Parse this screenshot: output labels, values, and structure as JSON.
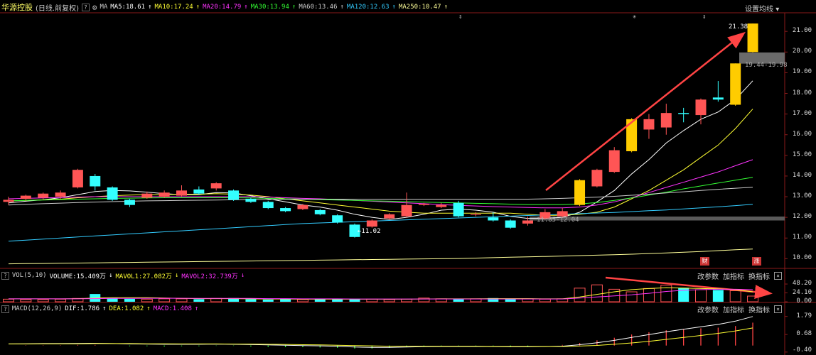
{
  "header": {
    "stock_name": "华源控股",
    "period": "(日线.前复权)",
    "help": "?",
    "indicator": "MA",
    "ma_items": [
      {
        "label": "MA5:18.61",
        "color": "#ffffff"
      },
      {
        "label": "MA10:17.24",
        "color": "#ffff33"
      },
      {
        "label": "MA20:14.79",
        "color": "#ff33ff"
      },
      {
        "label": "MA30:13.94",
        "color": "#33ff33"
      },
      {
        "label": "MA60:13.46",
        "color": "#cccccc"
      },
      {
        "label": "MA120:12.63",
        "color": "#33ccff"
      },
      {
        "label": "MA250:10.47",
        "color": "#ffff99"
      }
    ],
    "settings_label": "设置均线"
  },
  "price_axis": [
    "21.00",
    "20.00",
    "19.00",
    "18.00",
    "17.00",
    "16.00",
    "15.00",
    "14.00",
    "13.00",
    "12.00",
    "11.00",
    "10.00"
  ],
  "annotations": {
    "high_label": "21.38",
    "low_label": "11.02",
    "range_label_right": "19.44-19.98",
    "range_label_mid": "11.85-12.04"
  },
  "badges": {
    "cai": "财",
    "zhang": "涨"
  },
  "volume_panel": {
    "help": "?",
    "title": "VOL(5,10)",
    "volume": "VOLUME:15.409万",
    "mavol1": "MAVOL1:27.082万",
    "mavol2": "MAVOL2:32.739万",
    "tools": [
      "改参数",
      "加指标",
      "换指标"
    ],
    "close": "×",
    "axis": [
      "48.20",
      "24.10",
      "0.00"
    ]
  },
  "macd_panel": {
    "help": "?",
    "title": "MACD(12,26,9)",
    "dif": "DIF:1.786",
    "dea": "DEA:1.082",
    "macd": "MACD:1.408",
    "tools": [
      "改参数",
      "加指标",
      "换指标"
    ],
    "close": "×",
    "axis": [
      "1.79",
      "0.68",
      "-0.40"
    ]
  },
  "chart_data": {
    "type": "candlestick",
    "price_range": [
      9.6,
      21.9
    ],
    "candles": [
      {
        "o": 12.75,
        "c": 12.85,
        "h": 13.0,
        "l": 12.6
      },
      {
        "o": 12.9,
        "c": 13.05,
        "h": 13.1,
        "l": 12.8
      },
      {
        "o": 12.95,
        "c": 13.15,
        "h": 13.2,
        "l": 12.85
      },
      {
        "o": 13.0,
        "c": 13.2,
        "h": 13.3,
        "l": 12.9
      },
      {
        "o": 13.45,
        "c": 14.3,
        "h": 14.35,
        "l": 13.4
      },
      {
        "o": 14.0,
        "c": 13.5,
        "h": 14.1,
        "l": 13.3
      },
      {
        "o": 13.45,
        "c": 12.85,
        "h": 13.5,
        "l": 12.8
      },
      {
        "o": 12.85,
        "c": 12.6,
        "h": 12.9,
        "l": 12.5
      },
      {
        "o": 12.95,
        "c": 13.15,
        "h": 13.25,
        "l": 12.9
      },
      {
        "o": 13.0,
        "c": 13.2,
        "h": 13.3,
        "l": 12.95
      },
      {
        "o": 13.05,
        "c": 13.3,
        "h": 13.55,
        "l": 13.0
      },
      {
        "o": 13.35,
        "c": 13.15,
        "h": 13.5,
        "l": 13.1
      },
      {
        "o": 13.4,
        "c": 13.65,
        "h": 13.7,
        "l": 13.3
      },
      {
        "o": 13.3,
        "c": 12.85,
        "h": 13.35,
        "l": 12.8
      },
      {
        "o": 12.9,
        "c": 12.75,
        "h": 12.95,
        "l": 12.7
      },
      {
        "o": 12.75,
        "c": 12.45,
        "h": 12.8,
        "l": 12.4
      },
      {
        "o": 12.45,
        "c": 12.3,
        "h": 12.5,
        "l": 12.25
      },
      {
        "o": 12.4,
        "c": 12.6,
        "h": 12.65,
        "l": 12.35
      },
      {
        "o": 12.35,
        "c": 12.15,
        "h": 12.4,
        "l": 12.1
      },
      {
        "o": 12.1,
        "c": 11.75,
        "h": 12.15,
        "l": 11.7
      },
      {
        "o": 11.65,
        "c": 11.05,
        "h": 11.7,
        "l": 11.02
      },
      {
        "o": 11.55,
        "c": 11.85,
        "h": 11.9,
        "l": 11.5
      },
      {
        "o": 11.95,
        "c": 12.15,
        "h": 12.2,
        "l": 11.9
      },
      {
        "o": 12.05,
        "c": 12.6,
        "h": 13.2,
        "l": 12.0
      },
      {
        "o": 12.6,
        "c": 12.65,
        "h": 12.7,
        "l": 12.55
      },
      {
        "o": 12.5,
        "c": 12.6,
        "h": 12.7,
        "l": 12.45
      },
      {
        "o": 12.7,
        "c": 12.05,
        "h": 12.8,
        "l": 12.0
      },
      {
        "o": 12.15,
        "c": 12.15,
        "h": 12.25,
        "l": 12.05
      },
      {
        "o": 12.0,
        "c": 11.85,
        "h": 12.25,
        "l": 11.8
      },
      {
        "o": 11.85,
        "c": 11.5,
        "h": 11.9,
        "l": 11.45
      },
      {
        "o": 11.7,
        "c": 11.85,
        "h": 12.04,
        "l": 11.6
      },
      {
        "o": 11.95,
        "c": 12.25,
        "h": 12.4,
        "l": 11.9
      },
      {
        "o": 12.05,
        "c": 12.3,
        "h": 12.45,
        "l": 12.0
      },
      {
        "o": 12.6,
        "c": 13.8,
        "h": 13.85,
        "l": 12.55
      },
      {
        "o": 13.5,
        "c": 14.3,
        "h": 14.35,
        "l": 13.45
      },
      {
        "o": 14.2,
        "c": 15.25,
        "h": 15.4,
        "l": 14.15
      },
      {
        "o": 15.2,
        "c": 16.75,
        "h": 16.8,
        "l": 15.15
      },
      {
        "o": 16.25,
        "c": 16.75,
        "h": 17.0,
        "l": 15.8
      },
      {
        "o": 16.35,
        "c": 17.05,
        "h": 17.5,
        "l": 16.0
      },
      {
        "o": 17.05,
        "c": 17.0,
        "h": 17.3,
        "l": 16.6
      },
      {
        "o": 16.95,
        "c": 17.7,
        "h": 17.75,
        "l": 16.5
      },
      {
        "o": 17.8,
        "c": 17.7,
        "h": 18.6,
        "l": 17.6
      },
      {
        "o": 17.45,
        "c": 19.45,
        "h": 19.45,
        "l": 17.4
      },
      {
        "o": 20.0,
        "c": 21.38,
        "h": 21.38,
        "l": 19.98
      }
    ],
    "ma_series": [
      {
        "name": "MA5",
        "color": "#ffffff",
        "values": [
          12.7,
          12.78,
          12.85,
          12.95,
          13.1,
          13.25,
          13.3,
          13.28,
          13.22,
          13.15,
          13.1,
          13.1,
          13.2,
          13.18,
          13.05,
          12.9,
          12.75,
          12.6,
          12.5,
          12.35,
          12.15,
          12.0,
          11.9,
          12.0,
          12.15,
          12.35,
          12.4,
          12.35,
          12.25,
          12.05,
          11.95,
          11.95,
          12.0,
          12.25,
          12.75,
          13.3,
          14.1,
          14.8,
          15.6,
          16.2,
          16.75,
          17.1,
          17.7,
          18.61
        ]
      },
      {
        "name": "MA10",
        "color": "#ffff33",
        "values": [
          12.8,
          12.82,
          12.85,
          12.88,
          12.95,
          13.0,
          13.05,
          13.08,
          13.1,
          13.1,
          13.12,
          13.12,
          13.15,
          13.12,
          13.08,
          13.0,
          12.9,
          12.8,
          12.7,
          12.6,
          12.5,
          12.4,
          12.3,
          12.25,
          12.2,
          12.2,
          12.2,
          12.2,
          12.2,
          12.2,
          12.15,
          12.1,
          12.1,
          12.15,
          12.25,
          12.5,
          12.9,
          13.3,
          13.8,
          14.3,
          14.9,
          15.5,
          16.3,
          17.24
        ]
      },
      {
        "name": "MA20",
        "color": "#ff33ff",
        "values": [
          12.9,
          12.92,
          12.94,
          12.96,
          12.98,
          13.0,
          13.0,
          13.0,
          13.0,
          13.0,
          13.0,
          13.0,
          13.0,
          13.0,
          13.0,
          12.98,
          12.95,
          12.92,
          12.9,
          12.86,
          12.82,
          12.78,
          12.74,
          12.7,
          12.66,
          12.62,
          12.58,
          12.55,
          12.52,
          12.5,
          12.48,
          12.46,
          12.46,
          12.5,
          12.6,
          12.75,
          12.95,
          13.2,
          13.45,
          13.7,
          13.95,
          14.2,
          14.5,
          14.79
        ]
      },
      {
        "name": "MA30",
        "color": "#33ff33",
        "values": [
          12.8,
          12.82,
          12.84,
          12.86,
          12.88,
          12.9,
          12.92,
          12.93,
          12.94,
          12.95,
          12.95,
          12.95,
          12.95,
          12.95,
          12.94,
          12.92,
          12.9,
          12.88,
          12.86,
          12.84,
          12.82,
          12.8,
          12.78,
          12.76,
          12.74,
          12.72,
          12.7,
          12.68,
          12.66,
          12.64,
          12.62,
          12.62,
          12.62,
          12.65,
          12.72,
          12.82,
          12.94,
          13.08,
          13.22,
          13.38,
          13.52,
          13.66,
          13.8,
          13.94
        ]
      },
      {
        "name": "MA60",
        "color": "#cccccc",
        "values": [
          12.6,
          12.63,
          12.66,
          12.69,
          12.72,
          12.74,
          12.76,
          12.78,
          12.8,
          12.81,
          12.82,
          12.83,
          12.84,
          12.85,
          12.86,
          12.86,
          12.87,
          12.87,
          12.88,
          12.88,
          12.88,
          12.88,
          12.88,
          12.88,
          12.88,
          12.88,
          12.88,
          12.88,
          12.88,
          12.88,
          12.88,
          12.9,
          12.92,
          12.95,
          12.98,
          13.02,
          13.07,
          13.12,
          13.18,
          13.24,
          13.3,
          13.36,
          13.41,
          13.46
        ]
      },
      {
        "name": "MA120",
        "color": "#33ccff",
        "values": [
          10.85,
          10.9,
          10.95,
          11.0,
          11.05,
          11.1,
          11.15,
          11.2,
          11.25,
          11.3,
          11.35,
          11.4,
          11.45,
          11.5,
          11.55,
          11.6,
          11.65,
          11.7,
          11.73,
          11.76,
          11.79,
          11.82,
          11.85,
          11.88,
          11.91,
          11.94,
          11.97,
          12.0,
          12.03,
          12.06,
          12.09,
          12.12,
          12.15,
          12.18,
          12.21,
          12.24,
          12.28,
          12.32,
          12.36,
          12.41,
          12.46,
          12.51,
          12.57,
          12.63
        ]
      },
      {
        "name": "MA250",
        "color": "#ffff99",
        "values": [
          9.75,
          9.76,
          9.77,
          9.78,
          9.79,
          9.8,
          9.81,
          9.82,
          9.83,
          9.84,
          9.85,
          9.86,
          9.87,
          9.88,
          9.89,
          9.9,
          9.91,
          9.92,
          9.93,
          9.94,
          9.95,
          9.96,
          9.97,
          9.98,
          9.99,
          10.0,
          10.01,
          10.03,
          10.05,
          10.07,
          10.09,
          10.11,
          10.13,
          10.15,
          10.17,
          10.19,
          10.22,
          10.25,
          10.28,
          10.31,
          10.35,
          10.39,
          10.43,
          10.47
        ]
      }
    ],
    "volume": {
      "range": [
        0,
        56
      ],
      "values": [
        7,
        6,
        6,
        7,
        9,
        21,
        10,
        8,
        7,
        8,
        8,
        7,
        9,
        10,
        7,
        6,
        7,
        6,
        7,
        7,
        8,
        7,
        6,
        7,
        10,
        8,
        8,
        8,
        10,
        7,
        8,
        7,
        8,
        37,
        46,
        34,
        27,
        36,
        45,
        38,
        33,
        32,
        30,
        15.409
      ],
      "mavol1": [
        8,
        8,
        8,
        8,
        8.5,
        10,
        11,
        11,
        11,
        10,
        9,
        8.5,
        8.5,
        8.5,
        8,
        7.5,
        7.5,
        7,
        7,
        7,
        7,
        7,
        7,
        7,
        7.5,
        8,
        8,
        8,
        8.5,
        8.5,
        8.5,
        8,
        8,
        13,
        20,
        27,
        33,
        36,
        38,
        37,
        36,
        35,
        33,
        27.082
      ],
      "mavol2": [
        8,
        8,
        8,
        8,
        8,
        8.5,
        9,
        9,
        9.5,
        9.5,
        9.5,
        9,
        9,
        9,
        9,
        8.5,
        8.5,
        8,
        8,
        8,
        7.5,
        7.5,
        7.5,
        7.5,
        7.5,
        7.5,
        7.5,
        7.5,
        7.5,
        7.5,
        7.5,
        7.5,
        7.5,
        10,
        13,
        16,
        19,
        23,
        28,
        31,
        33,
        34,
        34,
        32.739
      ]
    },
    "macd": {
      "range": [
        -0.45,
        1.95
      ],
      "dif": [
        0.1,
        0.11,
        0.12,
        0.12,
        0.13,
        0.14,
        0.12,
        0.1,
        0.09,
        0.08,
        0.08,
        0.08,
        0.09,
        0.08,
        0.06,
        0.04,
        0.02,
        0.0,
        -0.02,
        -0.05,
        -0.09,
        -0.11,
        -0.11,
        -0.09,
        -0.07,
        -0.06,
        -0.06,
        -0.06,
        -0.07,
        -0.08,
        -0.08,
        -0.06,
        -0.04,
        0.05,
        0.17,
        0.32,
        0.5,
        0.67,
        0.85,
        1.0,
        1.15,
        1.3,
        1.5,
        1.786
      ],
      "dea": [
        0.1,
        0.1,
        0.11,
        0.11,
        0.11,
        0.12,
        0.12,
        0.12,
        0.11,
        0.11,
        0.1,
        0.1,
        0.1,
        0.09,
        0.09,
        0.08,
        0.07,
        0.05,
        0.04,
        0.02,
        0.0,
        -0.02,
        -0.04,
        -0.05,
        -0.05,
        -0.05,
        -0.05,
        -0.05,
        -0.06,
        -0.06,
        -0.06,
        -0.06,
        -0.06,
        -0.03,
        0.01,
        0.08,
        0.16,
        0.26,
        0.38,
        0.5,
        0.62,
        0.75,
        0.9,
        1.082
      ],
      "hist": [
        0.0,
        0.02,
        0.02,
        0.02,
        0.04,
        0.04,
        0.0,
        -0.04,
        -0.04,
        -0.06,
        -0.04,
        -0.04,
        -0.02,
        -0.02,
        -0.06,
        -0.08,
        -0.1,
        -0.1,
        -0.12,
        -0.14,
        -0.18,
        -0.18,
        -0.14,
        -0.08,
        -0.04,
        -0.02,
        -0.02,
        -0.02,
        -0.02,
        -0.04,
        -0.04,
        0.0,
        0.04,
        0.16,
        0.32,
        0.48,
        0.68,
        0.82,
        0.94,
        1.0,
        1.06,
        1.1,
        1.2,
        1.408
      ]
    }
  }
}
